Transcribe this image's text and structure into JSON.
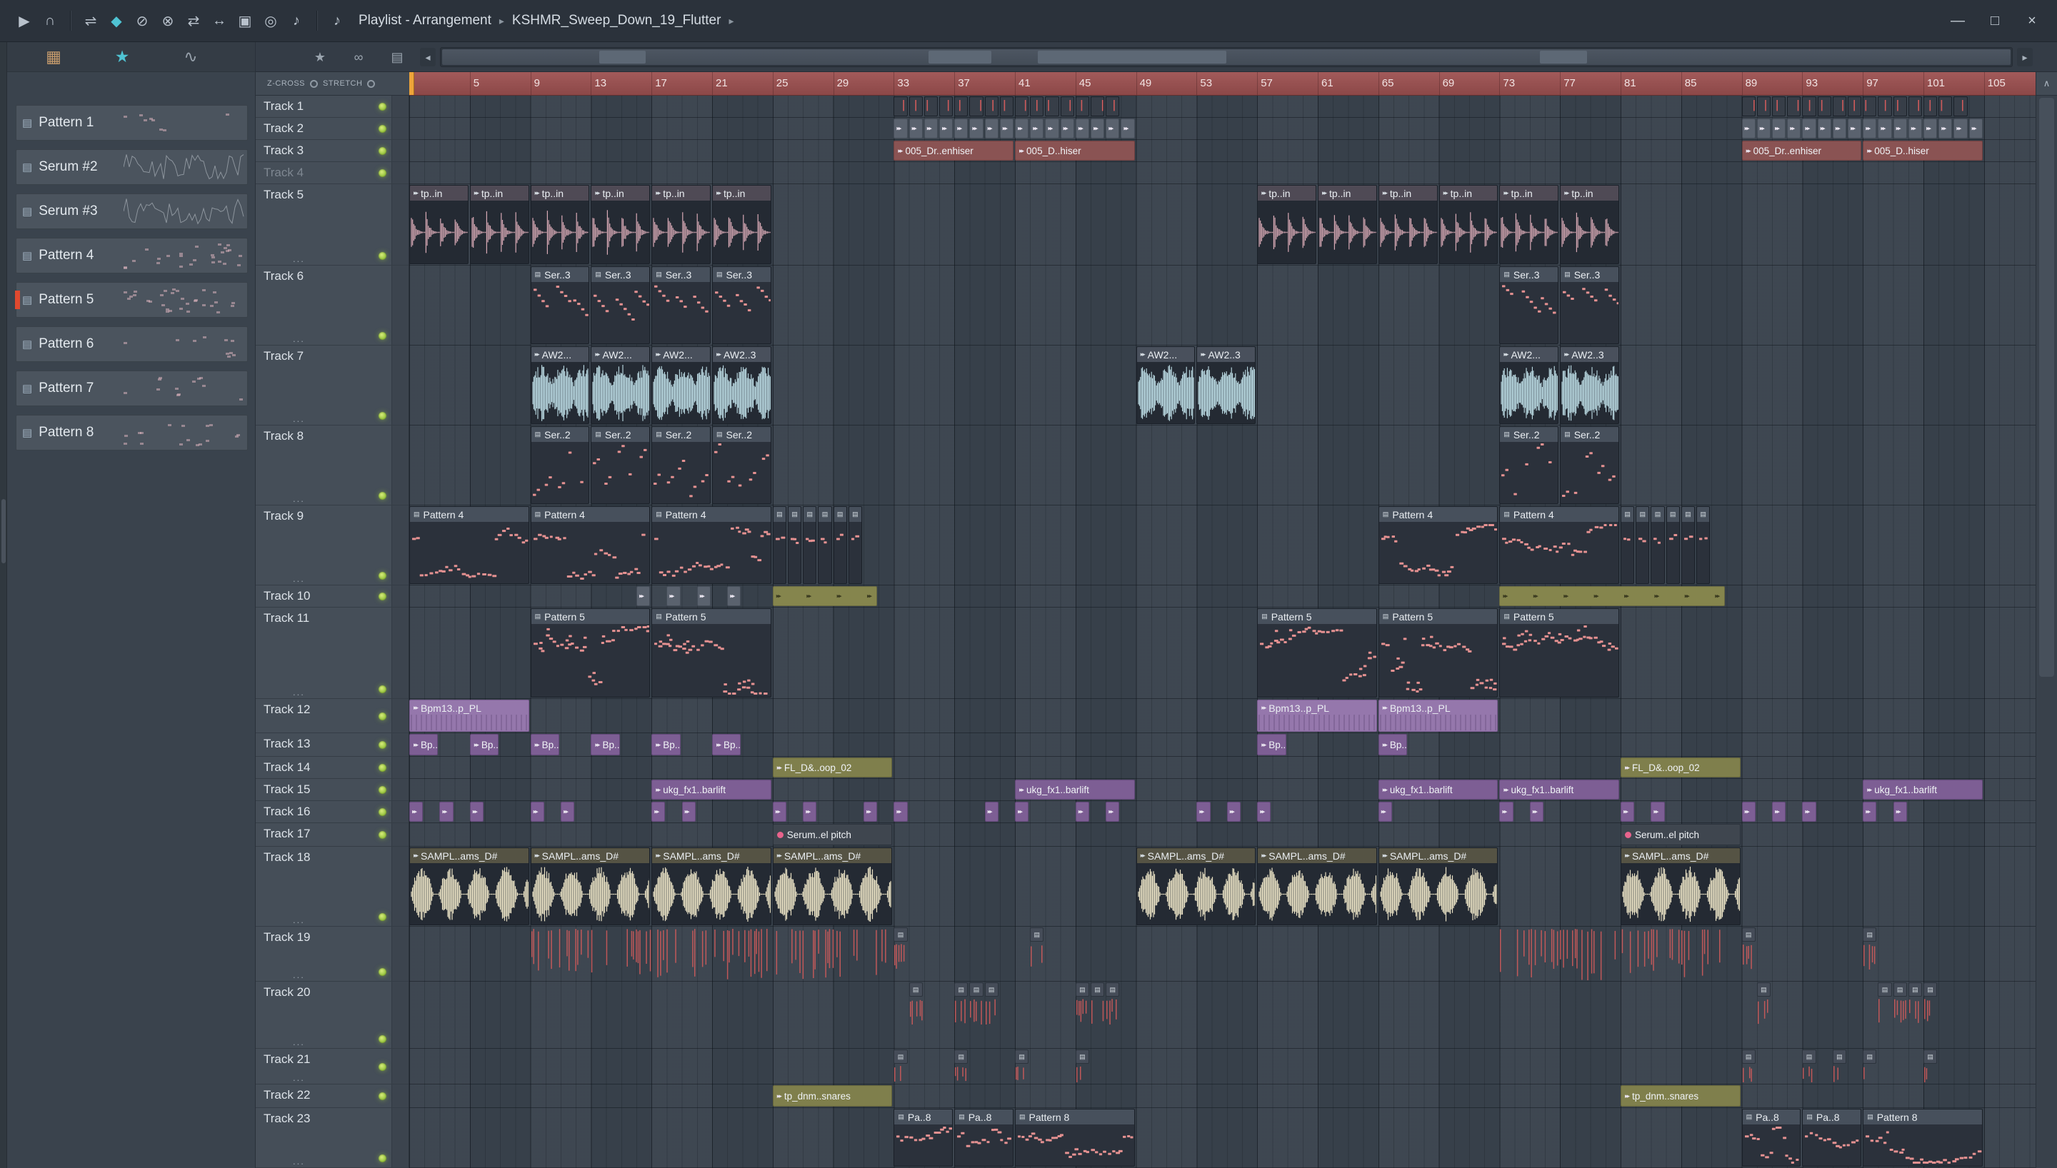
{
  "app": {
    "view_title": "Playlist - Arrangement",
    "project": "KSHMR_Sweep_Down_19_Flutter",
    "breadcrumb_sep": "▸"
  },
  "glyphs": {
    "clip_arrows": "▸▸",
    "clip_midi": "▤"
  },
  "toolbar": {
    "icons": [
      {
        "name": "play-icon",
        "glyph": "▶"
      },
      {
        "name": "headphones-icon",
        "glyph": "∩"
      },
      {
        "name": "sep"
      },
      {
        "name": "slip-tool-icon",
        "glyph": "⇌"
      },
      {
        "name": "paint-tool-icon",
        "glyph": "◆",
        "color": "#4fc3d3"
      },
      {
        "name": "delete-tool-icon",
        "glyph": "⊘"
      },
      {
        "name": "mute-tool-icon",
        "glyph": "⊗"
      },
      {
        "name": "playback-tool-icon",
        "glyph": "⇄"
      },
      {
        "name": "stretch-tool-icon",
        "glyph": "↔"
      },
      {
        "name": "select-tool-icon",
        "glyph": "▣"
      },
      {
        "name": "zoom-tool-icon",
        "glyph": "◎"
      },
      {
        "name": "preview-tool-icon",
        "glyph": "♪"
      },
      {
        "name": "sep"
      },
      {
        "name": "audition-icon",
        "glyph": "♪"
      }
    ],
    "window_buttons": [
      {
        "name": "minimize-button",
        "glyph": "—"
      },
      {
        "name": "maximize-button",
        "glyph": "□"
      },
      {
        "name": "close-button",
        "glyph": "×"
      }
    ]
  },
  "sidebar": {
    "icons": [
      {
        "name": "pattern-grid-icon",
        "glyph": "▦",
        "color": "#c49a6c"
      },
      {
        "name": "star-icon",
        "glyph": "★",
        "color": "#4fc3d3"
      },
      {
        "name": "automation-icon",
        "glyph": "∿",
        "color": "#96a0aa"
      }
    ],
    "items": [
      {
        "label": "Pattern 1",
        "preview": "notes",
        "density": 8
      },
      {
        "label": "Serum #2",
        "preview": "wave"
      },
      {
        "label": "Serum #3",
        "preview": "wave"
      },
      {
        "label": "Pattern 4",
        "preview": "notes",
        "density": 26
      },
      {
        "label": "Pattern 5",
        "preview": "notes",
        "density": 30,
        "selected": true
      },
      {
        "label": "Pattern 6",
        "preview": "notes",
        "density": 10
      },
      {
        "label": "Pattern 7",
        "preview": "notes",
        "density": 12
      },
      {
        "label": "Pattern 8",
        "preview": "notes",
        "density": 16
      }
    ]
  },
  "playlist": {
    "zcross_label": "Z-CROSS",
    "stretch_label": "STRETCH",
    "nav_left": "◂",
    "nav_right": "▸",
    "nav_up": "∧"
  },
  "ruler": {
    "first_label": 5,
    "last_label": 105,
    "step": 4
  },
  "tracks": [
    {
      "name": "Track 1",
      "h": 31
    },
    {
      "name": "Track 2",
      "h": 31
    },
    {
      "name": "Track 3",
      "h": 31
    },
    {
      "name": "Track 4",
      "h": 31,
      "muted": true
    },
    {
      "name": "Track 5",
      "h": 114,
      "sub": true
    },
    {
      "name": "Track 6",
      "h": 112,
      "sub": true
    },
    {
      "name": "Track 7",
      "h": 112,
      "sub": true
    },
    {
      "name": "Track 8",
      "h": 112,
      "sub": true
    },
    {
      "name": "Track 9",
      "h": 112,
      "sub": true
    },
    {
      "name": "Track 10",
      "h": 31
    },
    {
      "name": "Track 11",
      "h": 128,
      "sub": true
    },
    {
      "name": "Track 12",
      "h": 48
    },
    {
      "name": "Track 13",
      "h": 33
    },
    {
      "name": "Track 14",
      "h": 31
    },
    {
      "name": "Track 15",
      "h": 31
    },
    {
      "name": "Track 16",
      "h": 31
    },
    {
      "name": "Track 17",
      "h": 33
    },
    {
      "name": "Track 18",
      "h": 112,
      "sub": true
    },
    {
      "name": "Track 19",
      "h": 77,
      "sub": true
    },
    {
      "name": "Track 20",
      "h": 94,
      "sub": true
    },
    {
      "name": "Track 21",
      "h": 50,
      "sub": true
    },
    {
      "name": "Track 22",
      "h": 33
    },
    {
      "name": "Track 23",
      "h": 84,
      "sub": true
    }
  ],
  "colors": {
    "note": "#e59191",
    "tick": "#cf5b5b",
    "clip_body": "#242a33",
    "midi_body": "#2b313b",
    "head": "#47505c",
    "waves": {
      "decay": {
        "head": "#4f4a55",
        "color": "#d9aab6"
      },
      "dense": {
        "head": "#49505c",
        "color": "#bfdfe8"
      },
      "blob": {
        "head": "#555344",
        "color": "#e9e1c4"
      }
    },
    "label_colors": {
      "red": {
        "bg": "#8a5353",
        "bd": "#6d3f3f"
      },
      "purple2": {
        "bg": "#7d5e94",
        "bd": "#624878"
      },
      "olive": {
        "bg": "#7f7f4c",
        "bd": "#63633a"
      },
      "dark": {
        "bg": "#3f464f",
        "bd": "#2b323b"
      },
      "gray": {
        "bg": "#5a626e",
        "bd": "#444c57"
      }
    },
    "solid_purple": {
      "bg": "#9577ac",
      "bd": "#7a5c90"
    },
    "strip_olive": {
      "bg": "#85854d",
      "bd": "#696940"
    }
  },
  "clips": [
    {
      "t": 0,
      "b": 33,
      "l": 1,
      "type": "mini_notes",
      "rep": 15
    },
    {
      "t": 0,
      "b": 89,
      "l": 1,
      "type": "mini_notes",
      "rep": 15
    },
    {
      "t": 1,
      "b": 33,
      "l": 1,
      "type": "mini_arrow",
      "color": "gray",
      "rep": 16
    },
    {
      "t": 1,
      "b": 89,
      "l": 1,
      "type": "mini_arrow",
      "color": "gray",
      "rep": 16
    },
    {
      "t": 2,
      "b": 33,
      "l": 8,
      "type": "label",
      "color": "red",
      "icon": "arrows",
      "label": "005_Dr..enhiser"
    },
    {
      "t": 2,
      "b": 41,
      "l": 8,
      "type": "label",
      "color": "red",
      "icon": "arrows",
      "label": "005_D..hiser"
    },
    {
      "t": 2,
      "b": 89,
      "l": 8,
      "type": "label",
      "color": "red",
      "icon": "arrows",
      "label": "005_Dr..enhiser"
    },
    {
      "t": 2,
      "b": 97,
      "l": 8,
      "type": "label",
      "color": "red",
      "icon": "arrows",
      "label": "005_D..hiser"
    },
    {
      "t": 4,
      "b": 1,
      "l": 4,
      "type": "audio",
      "wave": "decay",
      "label": "tp..in",
      "rep": 6
    },
    {
      "t": 4,
      "b": 57,
      "l": 4,
      "type": "audio",
      "wave": "decay",
      "label": "tp..in",
      "rep": 6
    },
    {
      "t": 5,
      "b": 9,
      "l": 4,
      "type": "midi",
      "notes": "run",
      "label": "Ser..3",
      "rep": 4
    },
    {
      "t": 5,
      "b": 73,
      "l": 4,
      "type": "midi",
      "notes": "run",
      "label": "Ser..3",
      "rep": 2
    },
    {
      "t": 6,
      "b": 9,
      "l": 4,
      "type": "audio",
      "wave": "dense",
      "label": "AW2...",
      "rep": 3
    },
    {
      "t": 6,
      "b": 21,
      "l": 4,
      "type": "audio",
      "wave": "dense",
      "label": "AW2..3"
    },
    {
      "t": 6,
      "b": 49,
      "l": 4,
      "type": "audio",
      "wave": "dense",
      "label": "AW2..."
    },
    {
      "t": 6,
      "b": 53,
      "l": 4,
      "type": "audio",
      "wave": "dense",
      "label": "AW2..3"
    },
    {
      "t": 6,
      "b": 73,
      "l": 4,
      "type": "audio",
      "wave": "dense",
      "label": "AW2..."
    },
    {
      "t": 6,
      "b": 77,
      "l": 4,
      "type": "audio",
      "wave": "dense",
      "label": "AW2..3"
    },
    {
      "t": 7,
      "b": 9,
      "l": 4,
      "type": "midi",
      "notes": "pair",
      "label": "Ser..2",
      "rep": 4
    },
    {
      "t": 7,
      "b": 73,
      "l": 4,
      "type": "midi",
      "notes": "pair",
      "label": "Ser..2",
      "rep": 2
    },
    {
      "t": 8,
      "b": 1,
      "l": 8,
      "type": "midi",
      "notes": "dense",
      "label": "Pattern 4",
      "rep": 3
    },
    {
      "t": 8,
      "b": 25,
      "l": 1,
      "type": "mini_midi",
      "notes": "dense",
      "rep": 6
    },
    {
      "t": 8,
      "b": 65,
      "l": 8,
      "type": "midi",
      "notes": "dense",
      "label": "Pattern 4",
      "rep": 2
    },
    {
      "t": 8,
      "b": 81,
      "l": 1,
      "type": "mini_midi",
      "notes": "dense",
      "rep": 6
    },
    {
      "t": 9,
      "b": 16,
      "l": 1,
      "type": "mini_arrow",
      "color": "gray",
      "rep": 4,
      "step": 2
    },
    {
      "t": 9,
      "b": 25,
      "l": 7,
      "type": "strip_arrows",
      "every": 2
    },
    {
      "t": 9,
      "b": 73,
      "l": 15,
      "type": "strip_arrows",
      "every": 2
    },
    {
      "t": 10,
      "b": 9,
      "l": 8,
      "type": "midi",
      "notes": "dense2",
      "label": "Pattern 5",
      "rep": 2
    },
    {
      "t": 10,
      "b": 57,
      "l": 8,
      "type": "midi",
      "notes": "dense2",
      "label": "Pattern 5",
      "rep": 3
    },
    {
      "t": 11,
      "b": 1,
      "l": 8,
      "type": "solid",
      "label": "Bpm13..p_PL"
    },
    {
      "t": 11,
      "b": 57,
      "l": 8,
      "type": "solid",
      "label": "Bpm13..p_PL",
      "rep": 2
    },
    {
      "t": 12,
      "b": 1,
      "l": 2,
      "type": "label",
      "color": "purple2",
      "icon": "arrows",
      "label": "Bp..X"
    },
    {
      "t": 12,
      "b": 5,
      "l": 2,
      "type": "label",
      "color": "purple2",
      "icon": "arrows",
      "label": "Bp..FX"
    },
    {
      "t": 12,
      "b": 9,
      "l": 2,
      "type": "label",
      "color": "purple2",
      "icon": "arrows",
      "label": "Bp..X"
    },
    {
      "t": 12,
      "b": 13,
      "l": 2,
      "type": "label",
      "color": "purple2",
      "icon": "arrows",
      "label": "Bp..X"
    },
    {
      "t": 12,
      "b": 17,
      "l": 2,
      "type": "label",
      "color": "purple2",
      "icon": "arrows",
      "label": "Bp..FX"
    },
    {
      "t": 12,
      "b": 21,
      "l": 2,
      "type": "label",
      "color": "purple2",
      "icon": "arrows",
      "label": "Bp..X"
    },
    {
      "t": 12,
      "b": 57,
      "l": 2,
      "type": "label",
      "color": "purple2",
      "icon": "arrows",
      "label": "Bp..FX"
    },
    {
      "t": 12,
      "b": 65,
      "l": 2,
      "type": "label",
      "color": "purple2",
      "icon": "arrows",
      "label": "Bp..X"
    },
    {
      "t": 13,
      "b": 25,
      "l": 8,
      "type": "label",
      "color": "olive",
      "icon": "arrows",
      "label": "FL_D&..oop_02"
    },
    {
      "t": 13,
      "b": 81,
      "l": 8,
      "type": "label",
      "color": "olive",
      "icon": "arrows",
      "label": "FL_D&..oop_02"
    },
    {
      "t": 14,
      "bars": [
        17,
        41,
        65,
        73,
        97
      ],
      "l": 8,
      "type": "label",
      "color": "purple2",
      "icon": "arrows",
      "label": "ukg_fx1..barlift"
    },
    {
      "t": 15,
      "bars": [
        1,
        3,
        5,
        9,
        11,
        17,
        19,
        25,
        27,
        31,
        33,
        39,
        41,
        45,
        47,
        53,
        55,
        57,
        65,
        73,
        75,
        81,
        83,
        89,
        91,
        93,
        97,
        99
      ],
      "l": 1,
      "type": "mini_arrow",
      "color": "purple2"
    },
    {
      "t": 16,
      "b": 25,
      "l": 8,
      "type": "label",
      "color": "dark",
      "icon": "dot",
      "label": "Serum..el pitch"
    },
    {
      "t": 16,
      "b": 81,
      "l": 8,
      "type": "label",
      "color": "dark",
      "icon": "dot",
      "label": "Serum..el pitch"
    },
    {
      "t": 17,
      "b": 1,
      "l": 8,
      "type": "audio",
      "wave": "blob",
      "label": "SAMPL..ams_D#",
      "rep": 4
    },
    {
      "t": 17,
      "b": 49,
      "l": 8,
      "type": "audio",
      "wave": "blob",
      "label": "SAMPL..ams_D#",
      "rep": 3
    },
    {
      "t": 17,
      "b": 81,
      "l": 8,
      "type": "audio",
      "wave": "blob",
      "label": "SAMPL..ams_D#"
    },
    {
      "t": 18,
      "b": 9,
      "l": 24,
      "type": "ticks"
    },
    {
      "t": 18,
      "b": 73,
      "l": 15,
      "type": "ticks"
    },
    {
      "t": 18,
      "bars": [
        33,
        42,
        89,
        97
      ],
      "l": 1,
      "type": "mini_midi",
      "ticks": true
    },
    {
      "t": 19,
      "bars": [
        34,
        37,
        38,
        39,
        45,
        46,
        47,
        90,
        98,
        99,
        100,
        101
      ],
      "l": 1,
      "type": "mini_midi",
      "ticks": true
    },
    {
      "t": 20,
      "bars": [
        33,
        37,
        41,
        45,
        89,
        93,
        95,
        97,
        101
      ],
      "l": 1,
      "type": "mini_midi",
      "ticks": true
    },
    {
      "t": 21,
      "b": 25,
      "l": 8,
      "type": "label",
      "color": "olive",
      "icon": "arrows",
      "label": "tp_dnm..snares"
    },
    {
      "t": 21,
      "b": 81,
      "l": 8,
      "type": "label",
      "color": "olive",
      "icon": "arrows",
      "label": "tp_dnm..snares"
    },
    {
      "t": 22,
      "b": 33,
      "l": 4,
      "type": "midi",
      "notes": "dense",
      "label": "Pa..8"
    },
    {
      "t": 22,
      "b": 37,
      "l": 4,
      "type": "midi",
      "notes": "dense",
      "label": "Pa..8"
    },
    {
      "t": 22,
      "b": 41,
      "l": 8,
      "type": "midi",
      "notes": "dense",
      "label": "Pattern 8"
    },
    {
      "t": 22,
      "b": 89,
      "l": 4,
      "type": "midi",
      "notes": "dense",
      "label": "Pa..8"
    },
    {
      "t": 22,
      "b": 93,
      "l": 4,
      "type": "midi",
      "notes": "dense",
      "label": "Pa..8"
    },
    {
      "t": 22,
      "b": 97,
      "l": 8,
      "type": "midi",
      "notes": "dense",
      "label": "Pattern 8"
    }
  ]
}
